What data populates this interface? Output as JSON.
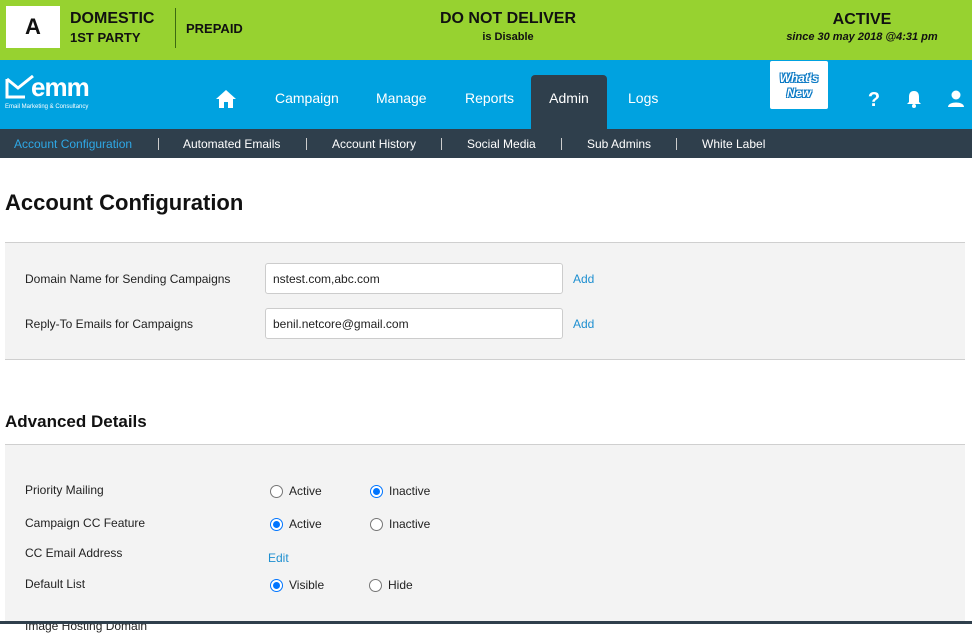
{
  "status": {
    "letter": "A",
    "domestic": "DOMESTIC",
    "party": "1ST PARTY",
    "prepaid": "PREPAID",
    "deliver": "DO NOT DELIVER",
    "deliver_sub": "is Disable",
    "active": "ACTIVE",
    "since": "since 30 may 2018 @4:31 pm",
    "background_color": "#97d230"
  },
  "brand": {
    "logo_text": "emm",
    "tagline": "Email Marketing & Consultancy",
    "nav_color": "#00a2e0"
  },
  "nav": {
    "home_icon": "home-icon",
    "items": [
      "Campaign",
      "Manage",
      "Reports",
      "Admin",
      "Logs"
    ],
    "active": "Admin",
    "whats_new_line1": "What's",
    "whats_new_line2": "New",
    "help_icon": "help-icon",
    "bell_icon": "bell-icon",
    "user_icon": "user-icon"
  },
  "subnav": {
    "items": [
      "Account Configuration",
      "Automated Emails",
      "Account History",
      "Social Media",
      "Sub Admins",
      "White Label"
    ],
    "active": "Account Configuration",
    "active_color": "#2ea8e6"
  },
  "page": {
    "title": "Account Configuration"
  },
  "config": {
    "domain_label": "Domain Name for Sending Campaigns",
    "domain_value": "nstest.com,abc.com",
    "reply_label": "Reply-To Emails for Campaigns",
    "reply_value": "benil.netcore@gmail.com",
    "add_label": "Add"
  },
  "advanced": {
    "title": "Advanced Details",
    "priority_label": "Priority Mailing",
    "priority_options": [
      "Active",
      "Inactive"
    ],
    "priority_selected": "Inactive",
    "cc_label": "Campaign CC Feature",
    "cc_options": [
      "Active",
      "Inactive"
    ],
    "cc_selected": "Active",
    "cc_email_label": "CC Email Address",
    "edit_label": "Edit",
    "default_list_label": "Default List",
    "default_list_options": [
      "Visible",
      "Hide"
    ],
    "default_list_selected": "Visible",
    "cut_off_label": "Image Hosting Domain"
  }
}
